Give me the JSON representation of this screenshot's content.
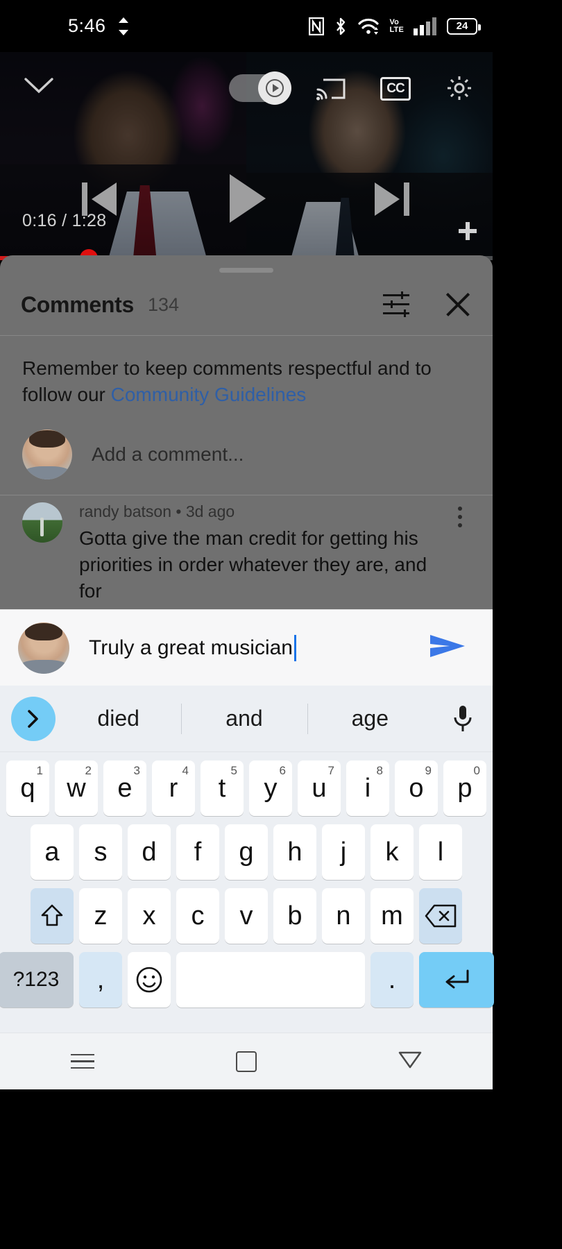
{
  "status_bar": {
    "time": "5:46",
    "sync_icon": "sync-arrows-icon",
    "nfc_icon": "nfc-icon",
    "bluetooth_icon": "bluetooth-icon",
    "wifi_icon": "wifi-icon",
    "volte_line1": "Vo",
    "volte_line2": "LTE",
    "signal_icon": "cellular-signal-icon",
    "battery_level": "24"
  },
  "player": {
    "collapse_icon": "chevron-down-icon",
    "autoplay_icon": "play-triangle-icon",
    "cast_icon": "cast-icon",
    "captions_label": "CC",
    "settings_icon": "gear-icon",
    "previous_icon": "skip-previous-icon",
    "play_icon": "play-icon",
    "next_icon": "skip-next-icon",
    "time_elapsed": "0:16",
    "time_separator": " / ",
    "time_total": "1:28",
    "time_display": "0:16 / 1:28",
    "fullscreen_icon": "fullscreen-icon",
    "progress_played_percent": 18,
    "progress_buffered_percent": 34,
    "progress_color": "#d01b1b"
  },
  "comments_sheet": {
    "drag_handle": "drag-handle",
    "title": "Comments",
    "count": "134",
    "filter_icon": "filter-sliders-icon",
    "close_icon": "close-icon",
    "guidelines_prefix": "Remember to keep comments respectful and to follow our ",
    "guidelines_link": "Community Guidelines",
    "guidelines_link_color": "#2f5fa6",
    "add_comment_placeholder": "Add a comment...",
    "add_comment_avatar": "user-avatar",
    "comments": [
      {
        "avatar": "commenter-avatar",
        "author": "randy batson",
        "separator": " • ",
        "timestamp": "3d ago",
        "meta": "randy batson • 3d ago",
        "text": "Gotta give the man credit for getting his priorities in order whatever they are, and for",
        "more_icon": "more-vertical-icon"
      }
    ]
  },
  "comment_input": {
    "avatar": "user-avatar",
    "value": "Truly a great musician",
    "placeholder": "Add a comment...",
    "cursor_color": "#1a73e8",
    "send_icon": "send-icon",
    "send_color": "#3b78e7"
  },
  "keyboard": {
    "expand_icon": "chevron-right-icon",
    "suggestions": [
      "died",
      "and",
      "age"
    ],
    "mic_icon": "microphone-icon",
    "rows": [
      [
        {
          "label": "q",
          "num": "1"
        },
        {
          "label": "w",
          "num": "2"
        },
        {
          "label": "e",
          "num": "3"
        },
        {
          "label": "r",
          "num": "4"
        },
        {
          "label": "t",
          "num": "5"
        },
        {
          "label": "y",
          "num": "6"
        },
        {
          "label": "u",
          "num": "7"
        },
        {
          "label": "i",
          "num": "8"
        },
        {
          "label": "o",
          "num": "9"
        },
        {
          "label": "p",
          "num": "0"
        }
      ],
      [
        {
          "label": "a"
        },
        {
          "label": "s"
        },
        {
          "label": "d"
        },
        {
          "label": "f"
        },
        {
          "label": "g"
        },
        {
          "label": "h"
        },
        {
          "label": "j"
        },
        {
          "label": "k"
        },
        {
          "label": "l"
        }
      ],
      [
        {
          "label": "z"
        },
        {
          "label": "x"
        },
        {
          "label": "c"
        },
        {
          "label": "v"
        },
        {
          "label": "b"
        },
        {
          "label": "n"
        },
        {
          "label": "m"
        }
      ]
    ],
    "shift_icon": "shift-up-arrow-icon",
    "backspace_icon": "backspace-icon",
    "symbols_label": "?123",
    "comma_label": ",",
    "emoji_icon": "smiley-face-icon",
    "space_label": "",
    "period_label": ".",
    "enter_icon": "enter-return-icon",
    "accent_color": "#74ccf6"
  },
  "nav_bar": {
    "recents_icon": "recents-menu-icon",
    "home_icon": "home-square-icon",
    "back_icon": "back-triangle-icon"
  }
}
